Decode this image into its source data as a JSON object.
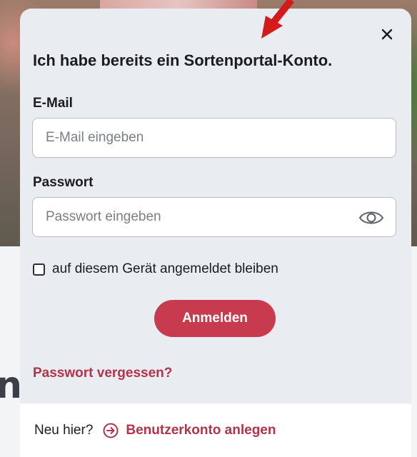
{
  "modal": {
    "title": "Ich habe bereits ein Sortenportal-Konto.",
    "email": {
      "label": "E-Mail",
      "placeholder": "E-Mail eingeben",
      "value": ""
    },
    "password": {
      "label": "Passwort",
      "placeholder": "Passwort eingeben",
      "value": ""
    },
    "remember_label": "auf diesem Gerät angemeldet bleiben",
    "remember_checked": false,
    "login_label": "Anmelden",
    "forgot_label": "Passwort vergessen?",
    "footer": {
      "question": "Neu hier?",
      "register_label": "Benutzerkonto anlegen"
    }
  },
  "icons": {
    "close": "close-icon",
    "password_toggle": "eye-icon",
    "register": "arrow-right-circle-icon",
    "annotation": "red-arrow"
  },
  "colors": {
    "accent": "#c83a4d",
    "link": "#b5324a",
    "modal_background": "#e9ecf1",
    "annotation_arrow": "#d41a1a"
  }
}
